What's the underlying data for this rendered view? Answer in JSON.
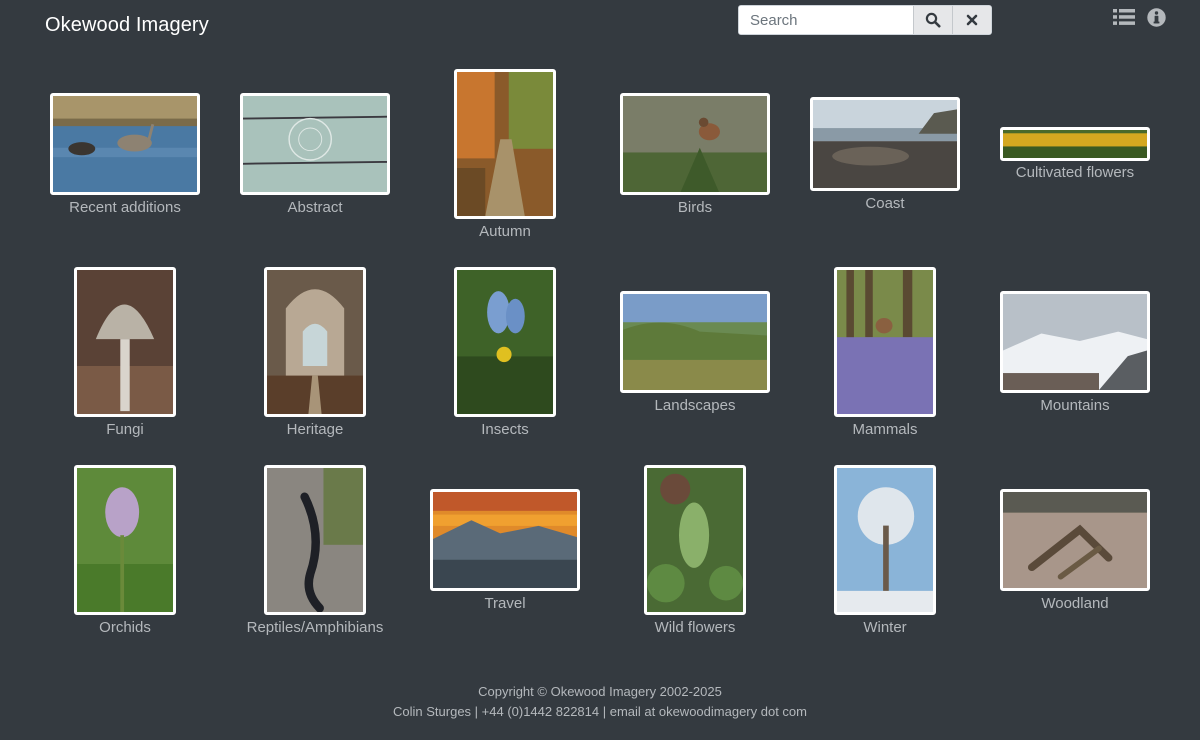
{
  "brand": "Okewood Imagery",
  "search": {
    "placeholder": "Search"
  },
  "toolbar": {
    "list_icon": "list-icon",
    "info_icon": "info-icon",
    "search_icon": "search-icon",
    "clear_icon": "close-icon"
  },
  "categories": [
    "Recent additions",
    "Abstract",
    "Autumn",
    "Birds",
    "Coast",
    "Cultivated flowers",
    "Fungi",
    "Heritage",
    "Insects",
    "Landscapes",
    "Mammals",
    "Mountains",
    "Orchids",
    "Reptiles/Amphibians",
    "Travel",
    "Wild flowers",
    "Winter",
    "Woodland"
  ],
  "footer": {
    "line1": "Copyright © Okewood Imagery 2002-2025",
    "line2": "Colin Sturges | +44 (0)1442 822814 | email at okewoodimagery dot com"
  },
  "colors": {
    "background": "#343a40",
    "label": "#b4b8bc",
    "frame": "#ffffff"
  }
}
